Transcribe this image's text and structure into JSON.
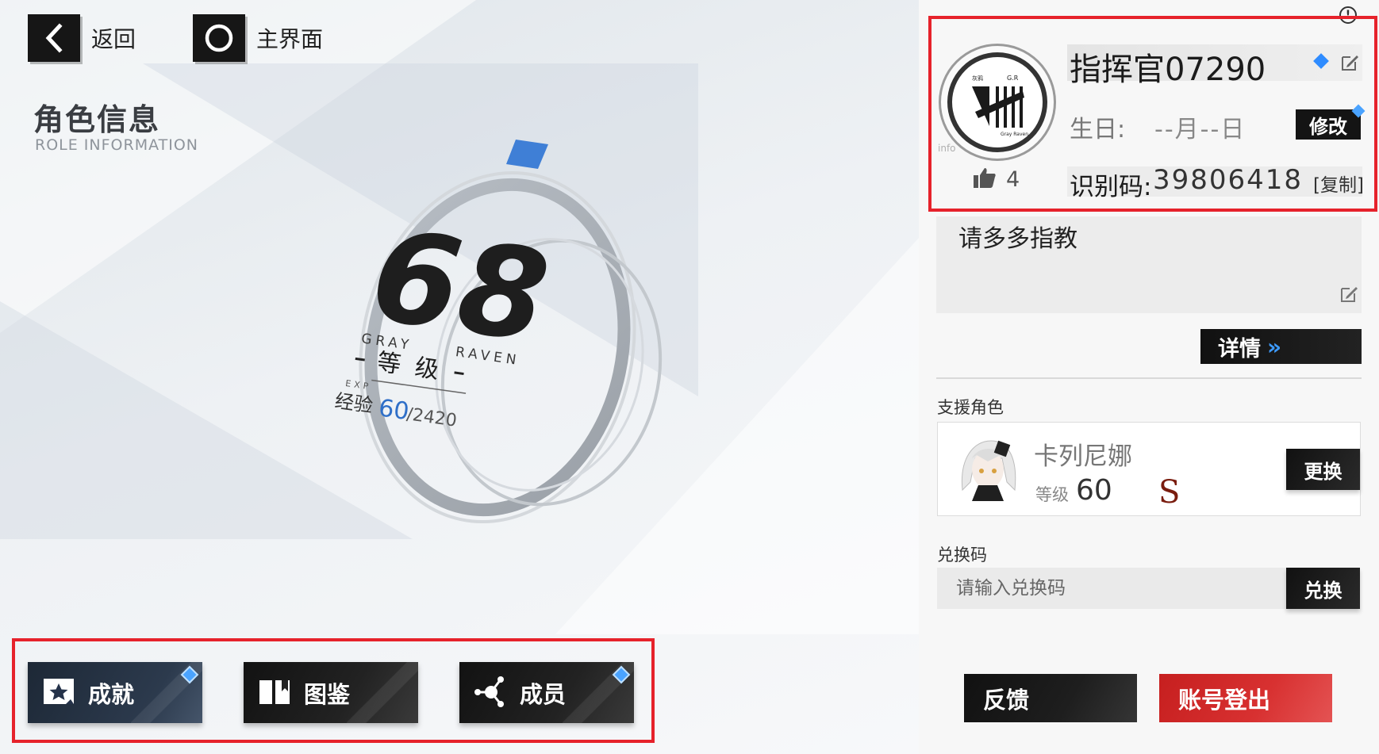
{
  "nav": {
    "back_label": "返回",
    "home_label": "主界面"
  },
  "role_header": {
    "title": "角色信息",
    "subtitle": "ROLE INFORMATION"
  },
  "level": {
    "value": "68",
    "team_left": "GRAY",
    "team_right": "RAVEN",
    "level_label": "等级",
    "exp_tag": "EXP",
    "exp_label": "经验",
    "exp_current": "60",
    "exp_total": "/2420",
    "exp_fraction": 0.0248
  },
  "bottom_tabs": [
    {
      "label": "成就",
      "icon": "achievement-star-icon",
      "active": true,
      "badge": true
    },
    {
      "label": "图鉴",
      "icon": "book-icon",
      "active": false,
      "badge": false
    },
    {
      "label": "成员",
      "icon": "network-nodes-icon",
      "active": false,
      "badge": true
    }
  ],
  "profile": {
    "name": "指挥官07290",
    "avatar_info": "info",
    "likes": "4",
    "birthday_label": "生日:",
    "birthday_value": "--月--日",
    "modify_label": "修改",
    "id_label": "识别码:",
    "id_value": "39806418",
    "copy_label": "[复制]",
    "signature": "请多多指教",
    "detail_label": "详情",
    "detail_arrow": "»"
  },
  "support": {
    "section_label": "支援角色",
    "character_name": "卡列尼娜",
    "level_label": "等级",
    "level_value": "60",
    "rank": "S",
    "swap_label": "更换"
  },
  "redeem": {
    "section_label": "兑换码",
    "placeholder": "请输入兑换码",
    "button_label": "兑换"
  },
  "footer": {
    "feedback_label": "反馈",
    "logout_label": "账号登出"
  },
  "colors": {
    "accent_blue": "#3d9bff",
    "highlight_red": "#e6222b",
    "logout_red": "#d02828"
  }
}
